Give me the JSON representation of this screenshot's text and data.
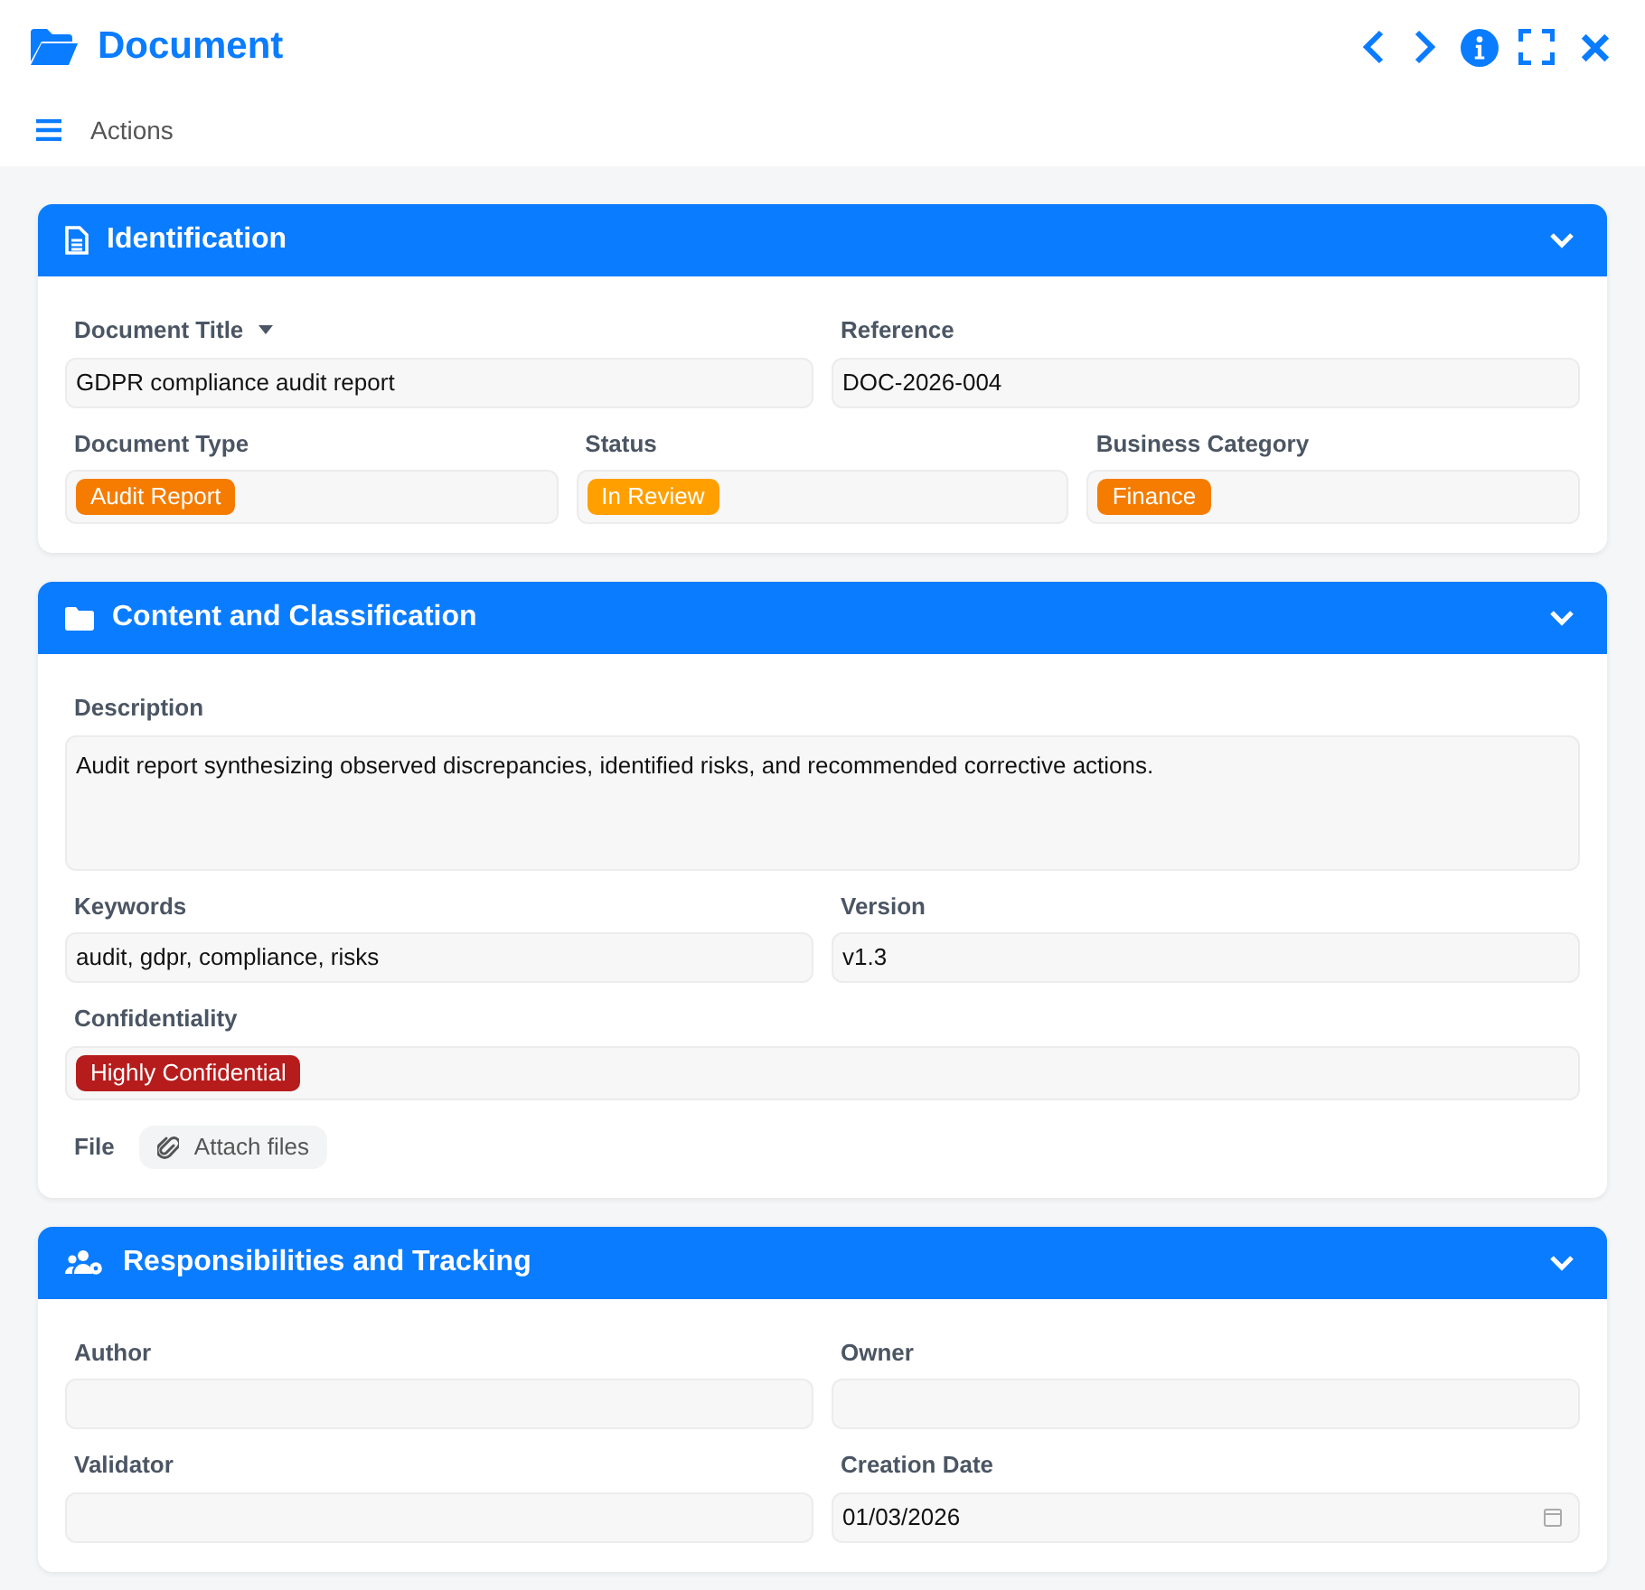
{
  "window": {
    "title": "Document"
  },
  "toolbar": {
    "actions_label": "Actions"
  },
  "sections": [
    {
      "title": "Identification",
      "expanded": true,
      "rows": [
        {
          "fields": [
            {
              "label": "Document Title",
              "kind": "text",
              "value": "GDPR compliance audit report",
              "dropdown": true
            },
            {
              "label": "Reference",
              "kind": "text",
              "value": "DOC-2026-004"
            }
          ]
        },
        {
          "fields": [
            {
              "label": "Document Type",
              "kind": "tag",
              "tag": {
                "text": "Audit Report",
                "color": "#f57c00"
              }
            },
            {
              "label": "Status",
              "kind": "tag",
              "tag": {
                "text": "In Review",
                "color": "#ffa000"
              }
            },
            {
              "label": "Business Category",
              "kind": "tag",
              "tag": {
                "text": "Finance",
                "color": "#f57c00"
              }
            }
          ]
        }
      ]
    },
    {
      "title": "Content and Classification",
      "expanded": true,
      "rows": [
        {
          "fields": [
            {
              "label": "Description",
              "kind": "textarea",
              "value": "Audit report synthesizing observed discrepancies, identified risks, and recommended corrective actions."
            }
          ]
        },
        {
          "fields": [
            {
              "label": "Keywords",
              "kind": "text",
              "value": "audit, gdpr, compliance, risks"
            },
            {
              "label": "Version",
              "kind": "text",
              "value": "v1.3"
            }
          ]
        },
        {
          "fields": [
            {
              "label": "Confidentiality",
              "kind": "tag",
              "tag": {
                "text": "Highly Confidential",
                "color": "#b71c1c"
              }
            }
          ]
        },
        {
          "fields": [
            {
              "label": "File",
              "kind": "file",
              "button": "Attach files"
            }
          ]
        }
      ]
    },
    {
      "title": "Responsibilities and Tracking",
      "expanded": true,
      "rows": [
        {
          "fields": [
            {
              "label": "Author",
              "kind": "text"
            },
            {
              "label": "Owner",
              "kind": "text"
            }
          ]
        },
        {
          "fields": [
            {
              "label": "Validator",
              "kind": "text"
            },
            {
              "label": "Creation Date",
              "kind": "date",
              "value": "01/03/2026"
            }
          ]
        }
      ]
    }
  ]
}
